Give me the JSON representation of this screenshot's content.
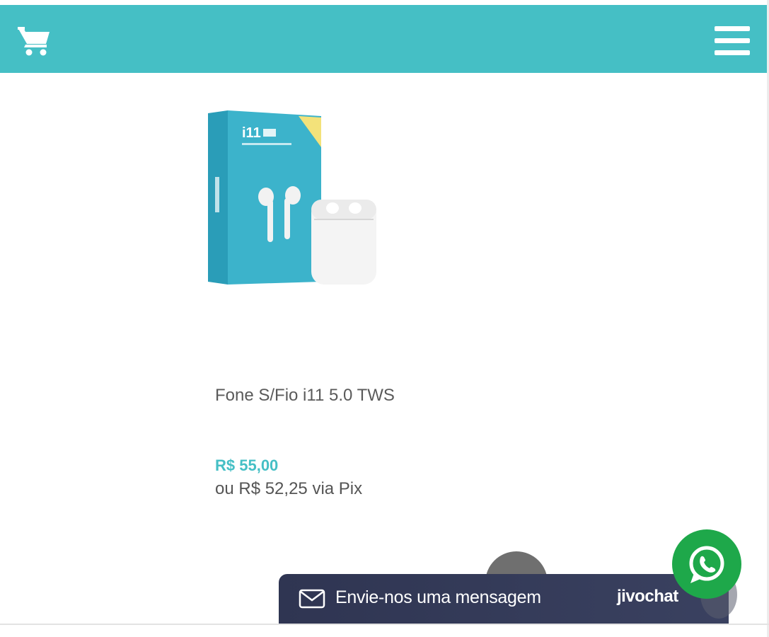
{
  "colors": {
    "brand": "#45bfc5",
    "whatsapp": "#1ea84a",
    "chat_bar": "#323854"
  },
  "header": {
    "cart_icon": "cart-icon",
    "menu_icon": "hamburger-menu-icon"
  },
  "product": {
    "image_alt_icon": "product-photo",
    "name": "Fone S/Fio i11 5.0 TWS",
    "price": "R$ 55,00",
    "pix_price": "ou R$ 52,25 via Pix"
  },
  "chat": {
    "label": "Envie-nos uma mensagem",
    "brand": "jivochat",
    "icon": "envelope-icon"
  },
  "whatsapp": {
    "icon": "whatsapp-icon"
  }
}
